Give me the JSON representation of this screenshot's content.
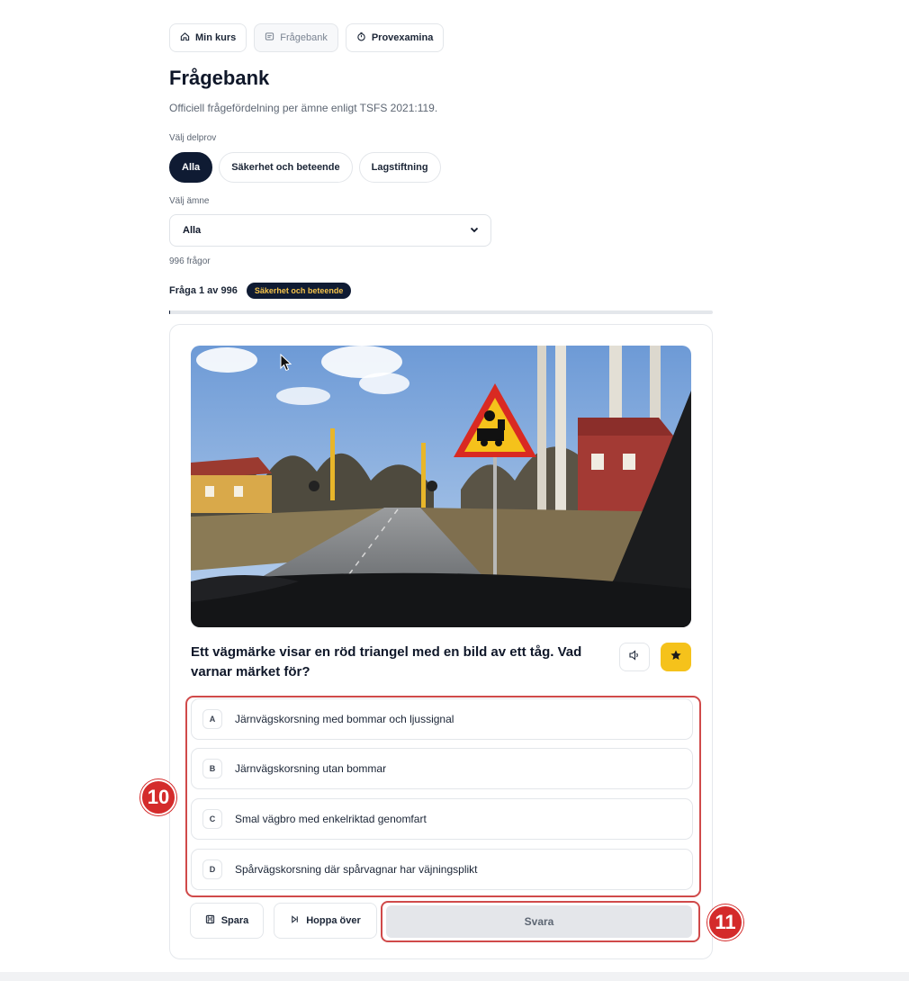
{
  "nav": {
    "my_course": "Min kurs",
    "question_bank": "Frågebank",
    "practice_exams": "Provexamina"
  },
  "header": {
    "title": "Frågebank",
    "subtitle": "Officiell frågefördelning per ämne enligt TSFS 2021:119."
  },
  "subtest": {
    "label": "Välj delprov",
    "options": [
      "Alla",
      "Säkerhet och beteende",
      "Lagstiftning"
    ],
    "selected": "Alla"
  },
  "subject": {
    "label": "Välj ämne",
    "value": "Alla"
  },
  "question_total": "996 frågor",
  "question_meta": {
    "counter": "Fråga 1 av 996",
    "category_badge": "Säkerhet och beteende",
    "progress_fraction": 0.001
  },
  "question": {
    "text": "Ett vägmärke visar en röd triangel med en bild av ett tåg. Vad varnar märket för?",
    "answers": [
      {
        "letter": "A",
        "text": "Järnvägskorsning med bommar och ljussignal"
      },
      {
        "letter": "B",
        "text": "Järnvägskorsning utan bommar"
      },
      {
        "letter": "C",
        "text": "Smal vägbro med enkelriktad genomfart"
      },
      {
        "letter": "D",
        "text": "Spårvägskorsning där spårvagnar har väjningsplikt"
      }
    ]
  },
  "actions": {
    "save": "Spara",
    "skip": "Hoppa över",
    "answer": "Svara"
  },
  "annotations": {
    "marker_answers": "10",
    "marker_submit": "11"
  },
  "colors": {
    "primary": "#0f1b33",
    "accent": "#f5c21b",
    "annotation": "#d42b2b"
  }
}
